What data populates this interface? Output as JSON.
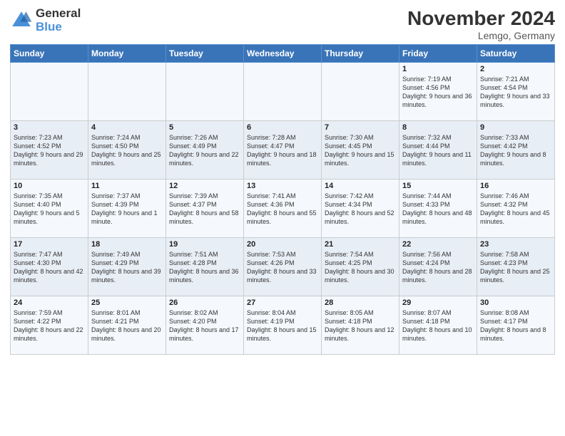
{
  "logo": {
    "line1": "General",
    "line2": "Blue"
  },
  "title": "November 2024",
  "location": "Lemgo, Germany",
  "days_of_week": [
    "Sunday",
    "Monday",
    "Tuesday",
    "Wednesday",
    "Thursday",
    "Friday",
    "Saturday"
  ],
  "weeks": [
    [
      {
        "day": "",
        "info": ""
      },
      {
        "day": "",
        "info": ""
      },
      {
        "day": "",
        "info": ""
      },
      {
        "day": "",
        "info": ""
      },
      {
        "day": "",
        "info": ""
      },
      {
        "day": "1",
        "info": "Sunrise: 7:19 AM\nSunset: 4:56 PM\nDaylight: 9 hours\nand 36 minutes."
      },
      {
        "day": "2",
        "info": "Sunrise: 7:21 AM\nSunset: 4:54 PM\nDaylight: 9 hours\nand 33 minutes."
      }
    ],
    [
      {
        "day": "3",
        "info": "Sunrise: 7:23 AM\nSunset: 4:52 PM\nDaylight: 9 hours\nand 29 minutes."
      },
      {
        "day": "4",
        "info": "Sunrise: 7:24 AM\nSunset: 4:50 PM\nDaylight: 9 hours\nand 25 minutes."
      },
      {
        "day": "5",
        "info": "Sunrise: 7:26 AM\nSunset: 4:49 PM\nDaylight: 9 hours\nand 22 minutes."
      },
      {
        "day": "6",
        "info": "Sunrise: 7:28 AM\nSunset: 4:47 PM\nDaylight: 9 hours\nand 18 minutes."
      },
      {
        "day": "7",
        "info": "Sunrise: 7:30 AM\nSunset: 4:45 PM\nDaylight: 9 hours\nand 15 minutes."
      },
      {
        "day": "8",
        "info": "Sunrise: 7:32 AM\nSunset: 4:44 PM\nDaylight: 9 hours\nand 11 minutes."
      },
      {
        "day": "9",
        "info": "Sunrise: 7:33 AM\nSunset: 4:42 PM\nDaylight: 9 hours\nand 8 minutes."
      }
    ],
    [
      {
        "day": "10",
        "info": "Sunrise: 7:35 AM\nSunset: 4:40 PM\nDaylight: 9 hours\nand 5 minutes."
      },
      {
        "day": "11",
        "info": "Sunrise: 7:37 AM\nSunset: 4:39 PM\nDaylight: 9 hours\nand 1 minute."
      },
      {
        "day": "12",
        "info": "Sunrise: 7:39 AM\nSunset: 4:37 PM\nDaylight: 8 hours\nand 58 minutes."
      },
      {
        "day": "13",
        "info": "Sunrise: 7:41 AM\nSunset: 4:36 PM\nDaylight: 8 hours\nand 55 minutes."
      },
      {
        "day": "14",
        "info": "Sunrise: 7:42 AM\nSunset: 4:34 PM\nDaylight: 8 hours\nand 52 minutes."
      },
      {
        "day": "15",
        "info": "Sunrise: 7:44 AM\nSunset: 4:33 PM\nDaylight: 8 hours\nand 48 minutes."
      },
      {
        "day": "16",
        "info": "Sunrise: 7:46 AM\nSunset: 4:32 PM\nDaylight: 8 hours\nand 45 minutes."
      }
    ],
    [
      {
        "day": "17",
        "info": "Sunrise: 7:47 AM\nSunset: 4:30 PM\nDaylight: 8 hours\nand 42 minutes."
      },
      {
        "day": "18",
        "info": "Sunrise: 7:49 AM\nSunset: 4:29 PM\nDaylight: 8 hours\nand 39 minutes."
      },
      {
        "day": "19",
        "info": "Sunrise: 7:51 AM\nSunset: 4:28 PM\nDaylight: 8 hours\nand 36 minutes."
      },
      {
        "day": "20",
        "info": "Sunrise: 7:53 AM\nSunset: 4:26 PM\nDaylight: 8 hours\nand 33 minutes."
      },
      {
        "day": "21",
        "info": "Sunrise: 7:54 AM\nSunset: 4:25 PM\nDaylight: 8 hours\nand 30 minutes."
      },
      {
        "day": "22",
        "info": "Sunrise: 7:56 AM\nSunset: 4:24 PM\nDaylight: 8 hours\nand 28 minutes."
      },
      {
        "day": "23",
        "info": "Sunrise: 7:58 AM\nSunset: 4:23 PM\nDaylight: 8 hours\nand 25 minutes."
      }
    ],
    [
      {
        "day": "24",
        "info": "Sunrise: 7:59 AM\nSunset: 4:22 PM\nDaylight: 8 hours\nand 22 minutes."
      },
      {
        "day": "25",
        "info": "Sunrise: 8:01 AM\nSunset: 4:21 PM\nDaylight: 8 hours\nand 20 minutes."
      },
      {
        "day": "26",
        "info": "Sunrise: 8:02 AM\nSunset: 4:20 PM\nDaylight: 8 hours\nand 17 minutes."
      },
      {
        "day": "27",
        "info": "Sunrise: 8:04 AM\nSunset: 4:19 PM\nDaylight: 8 hours\nand 15 minutes."
      },
      {
        "day": "28",
        "info": "Sunrise: 8:05 AM\nSunset: 4:18 PM\nDaylight: 8 hours\nand 12 minutes."
      },
      {
        "day": "29",
        "info": "Sunrise: 8:07 AM\nSunset: 4:18 PM\nDaylight: 8 hours\nand 10 minutes."
      },
      {
        "day": "30",
        "info": "Sunrise: 8:08 AM\nSunset: 4:17 PM\nDaylight: 8 hours\nand 8 minutes."
      }
    ]
  ]
}
